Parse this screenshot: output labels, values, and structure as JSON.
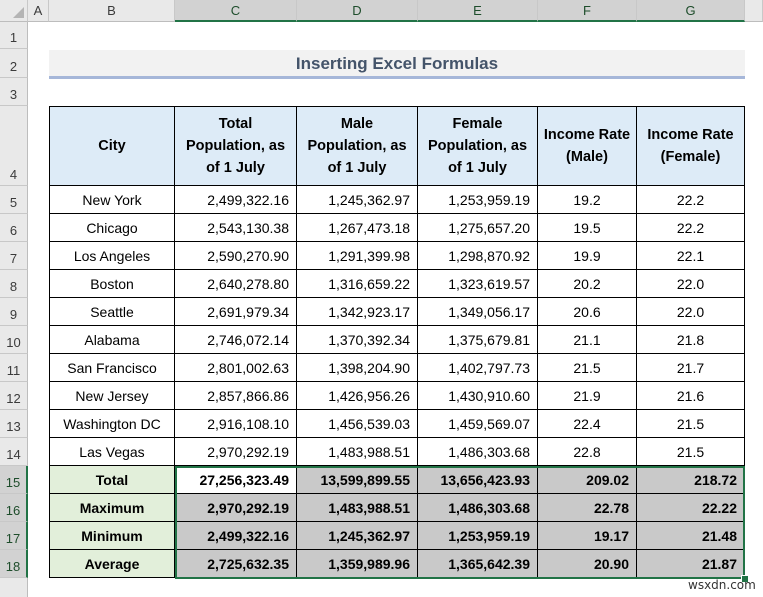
{
  "sheet": {
    "columns": [
      "A",
      "B",
      "C",
      "D",
      "E",
      "F",
      "G"
    ],
    "rows": [
      "1",
      "2",
      "3",
      "4",
      "5",
      "6",
      "7",
      "8",
      "9",
      "10",
      "11",
      "12",
      "13",
      "14",
      "15",
      "16",
      "17",
      "18"
    ],
    "selected_columns": [
      "C",
      "D",
      "E",
      "F",
      "G"
    ],
    "selected_rows": [
      "15",
      "16",
      "17",
      "18"
    ],
    "selection_color": "#217346"
  },
  "title": "Inserting Excel Formulas",
  "table": {
    "headers": [
      "City",
      "Total Population, as of 1 July",
      "Male Population, as of 1 July",
      "Female Population, as of 1 July",
      "Income Rate (Male)",
      "Income Rate (Female)"
    ],
    "rows": [
      [
        "New York",
        "2,499,322.16",
        "1,245,362.97",
        "1,253,959.19",
        "19.2",
        "22.2"
      ],
      [
        "Chicago",
        "2,543,130.38",
        "1,267,473.18",
        "1,275,657.20",
        "19.5",
        "22.2"
      ],
      [
        "Los Angeles",
        "2,590,270.90",
        "1,291,399.98",
        "1,298,870.92",
        "19.9",
        "22.1"
      ],
      [
        "Boston",
        "2,640,278.80",
        "1,316,659.22",
        "1,323,619.57",
        "20.2",
        "22.0"
      ],
      [
        "Seattle",
        "2,691,979.34",
        "1,342,923.17",
        "1,349,056.17",
        "20.6",
        "22.0"
      ],
      [
        "Alabama",
        "2,746,072.14",
        "1,370,392.34",
        "1,375,679.81",
        "21.1",
        "21.8"
      ],
      [
        "San Francisco",
        "2,801,002.63",
        "1,398,204.90",
        "1,402,797.73",
        "21.5",
        "21.7"
      ],
      [
        "New Jersey",
        "2,857,866.86",
        "1,426,956.26",
        "1,430,910.60",
        "21.9",
        "21.6"
      ],
      [
        "Washington DC",
        "2,916,108.10",
        "1,456,539.03",
        "1,459,569.07",
        "22.4",
        "21.5"
      ],
      [
        "Las Vegas",
        "2,970,292.19",
        "1,483,988.51",
        "1,486,303.68",
        "22.8",
        "21.5"
      ]
    ],
    "summary": [
      [
        "Total",
        "27,256,323.49",
        "13,599,899.55",
        "13,656,423.93",
        "209.02",
        "218.72"
      ],
      [
        "Maximum",
        "2,970,292.19",
        "1,483,988.51",
        "1,486,303.68",
        "22.78",
        "22.22"
      ],
      [
        "Minimum",
        "2,499,322.16",
        "1,245,362.97",
        "1,253,959.19",
        "19.17",
        "21.48"
      ],
      [
        "Average",
        "2,725,632.35",
        "1,359,989.96",
        "1,365,642.39",
        "20.90",
        "21.87"
      ]
    ]
  },
  "watermark": "wsxdn.com"
}
